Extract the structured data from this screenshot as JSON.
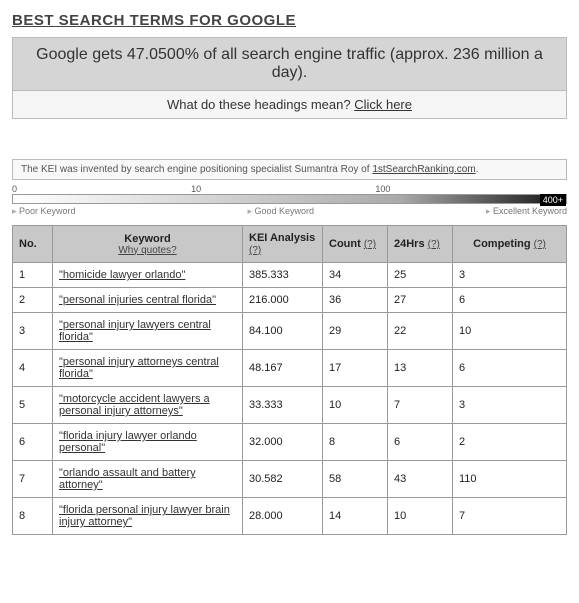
{
  "title": "BEST SEARCH TERMS FOR GOOGLE",
  "banner": {
    "main": "Google gets 47.0500% of all search engine traffic (approx. 236 million a day).",
    "sub_prefix": "What do these headings mean? ",
    "sub_link": "Click here"
  },
  "kei_note": {
    "text_prefix": "The KEI was invented by search engine positioning specialist Sumantra Roy of ",
    "link": "1stSearchRanking.com",
    "suffix": "."
  },
  "scale": {
    "t0": "0",
    "t1": "10",
    "t2": "100",
    "t3": "400+",
    "l0": "Poor Keyword",
    "l1": "Good Keyword",
    "l2": "Excellent Keyword"
  },
  "headers": {
    "no": "No.",
    "keyword": "Keyword",
    "keyword_sub": "Why quotes?",
    "kei": "KEI Analysis",
    "count": "Count",
    "hrs": "24Hrs",
    "competing": "Competing",
    "q": "(?)"
  },
  "rows": [
    {
      "no": "1",
      "kw": "\"homicide lawyer orlando\"",
      "kei": "385.333",
      "count": "34",
      "hrs": "25",
      "comp": "3"
    },
    {
      "no": "2",
      "kw": "\"personal injuries central florida\"",
      "kei": "216.000",
      "count": "36",
      "hrs": "27",
      "comp": "6"
    },
    {
      "no": "3",
      "kw": "\"personal injury lawyers central florida\"",
      "kei": "84.100",
      "count": "29",
      "hrs": "22",
      "comp": "10"
    },
    {
      "no": "4",
      "kw": "\"personal injury attorneys central florida\"",
      "kei": "48.167",
      "count": "17",
      "hrs": "13",
      "comp": "6"
    },
    {
      "no": "5",
      "kw": "\"motorcycle accident lawyers a personal injury attorneys\"",
      "kei": "33.333",
      "count": "10",
      "hrs": "7",
      "comp": "3"
    },
    {
      "no": "6",
      "kw": "\"florida injury lawyer orlando personal\"",
      "kei": "32.000",
      "count": "8",
      "hrs": "6",
      "comp": "2"
    },
    {
      "no": "7",
      "kw": "\"orlando assault and battery attorney\"",
      "kei": "30.582",
      "count": "58",
      "hrs": "43",
      "comp": "110"
    },
    {
      "no": "8",
      "kw": "\"florida personal injury lawyer brain injury attorney\"",
      "kei": "28.000",
      "count": "14",
      "hrs": "10",
      "comp": "7"
    }
  ]
}
